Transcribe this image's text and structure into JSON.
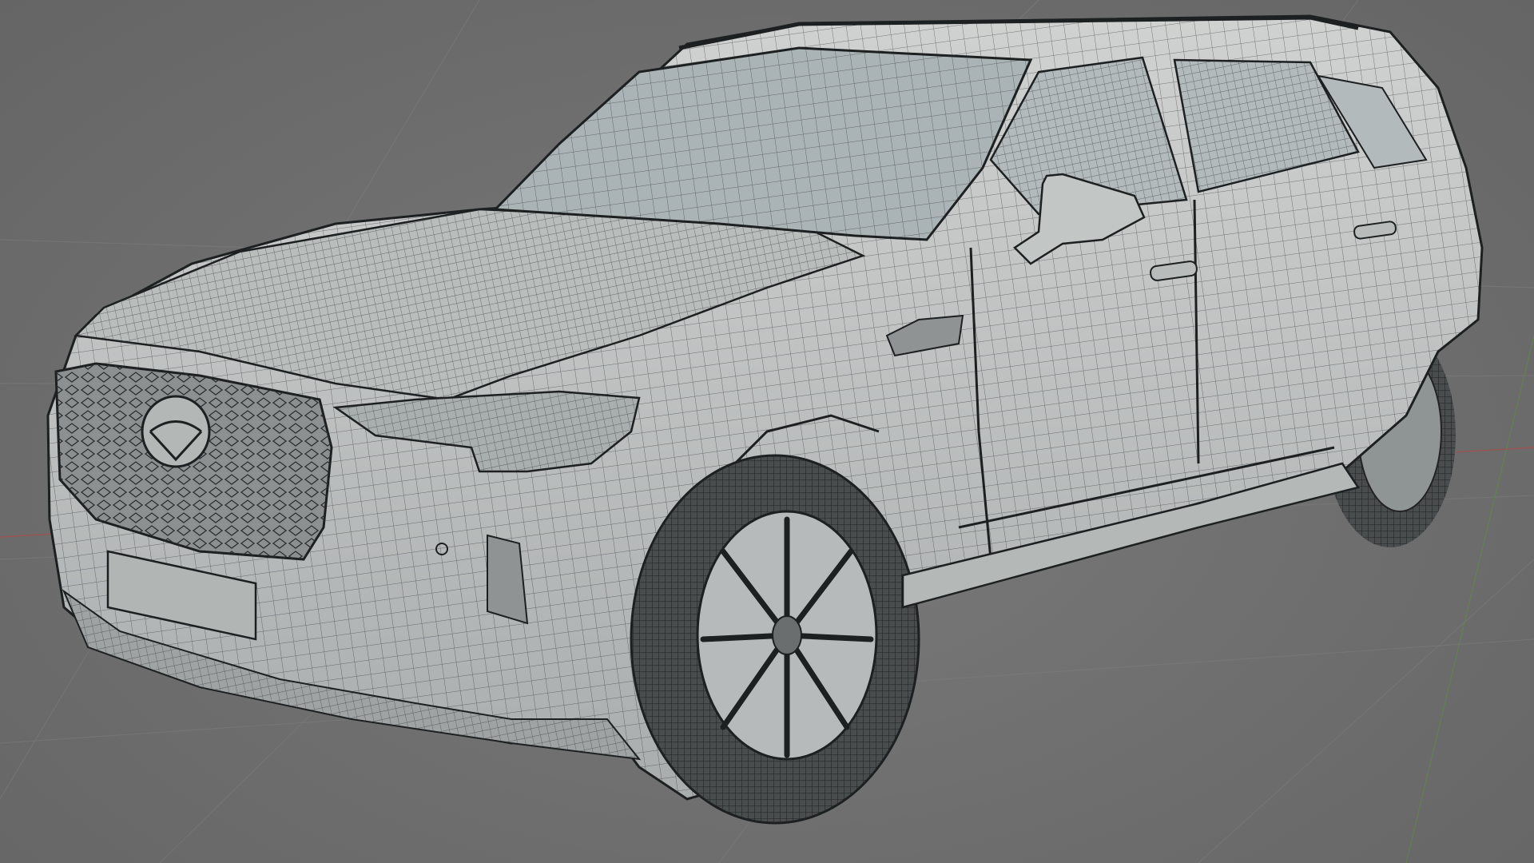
{
  "viewport": {
    "mode": "wireframe-overlay",
    "object_type": "suv-3d-model",
    "colors": {
      "background": "#6f6f6f",
      "grid_line": "#7c7c7c",
      "axis_x": "#b04a4a",
      "axis_y": "#5e8f3e",
      "body": "#c9cbca",
      "body_shadow": "#9ea2a2",
      "glass": "#aeb8bb",
      "wire": "#2a2e2f",
      "tire": "#4a4d4e",
      "rim": "#b7baba",
      "grille": "#8c9090"
    }
  }
}
